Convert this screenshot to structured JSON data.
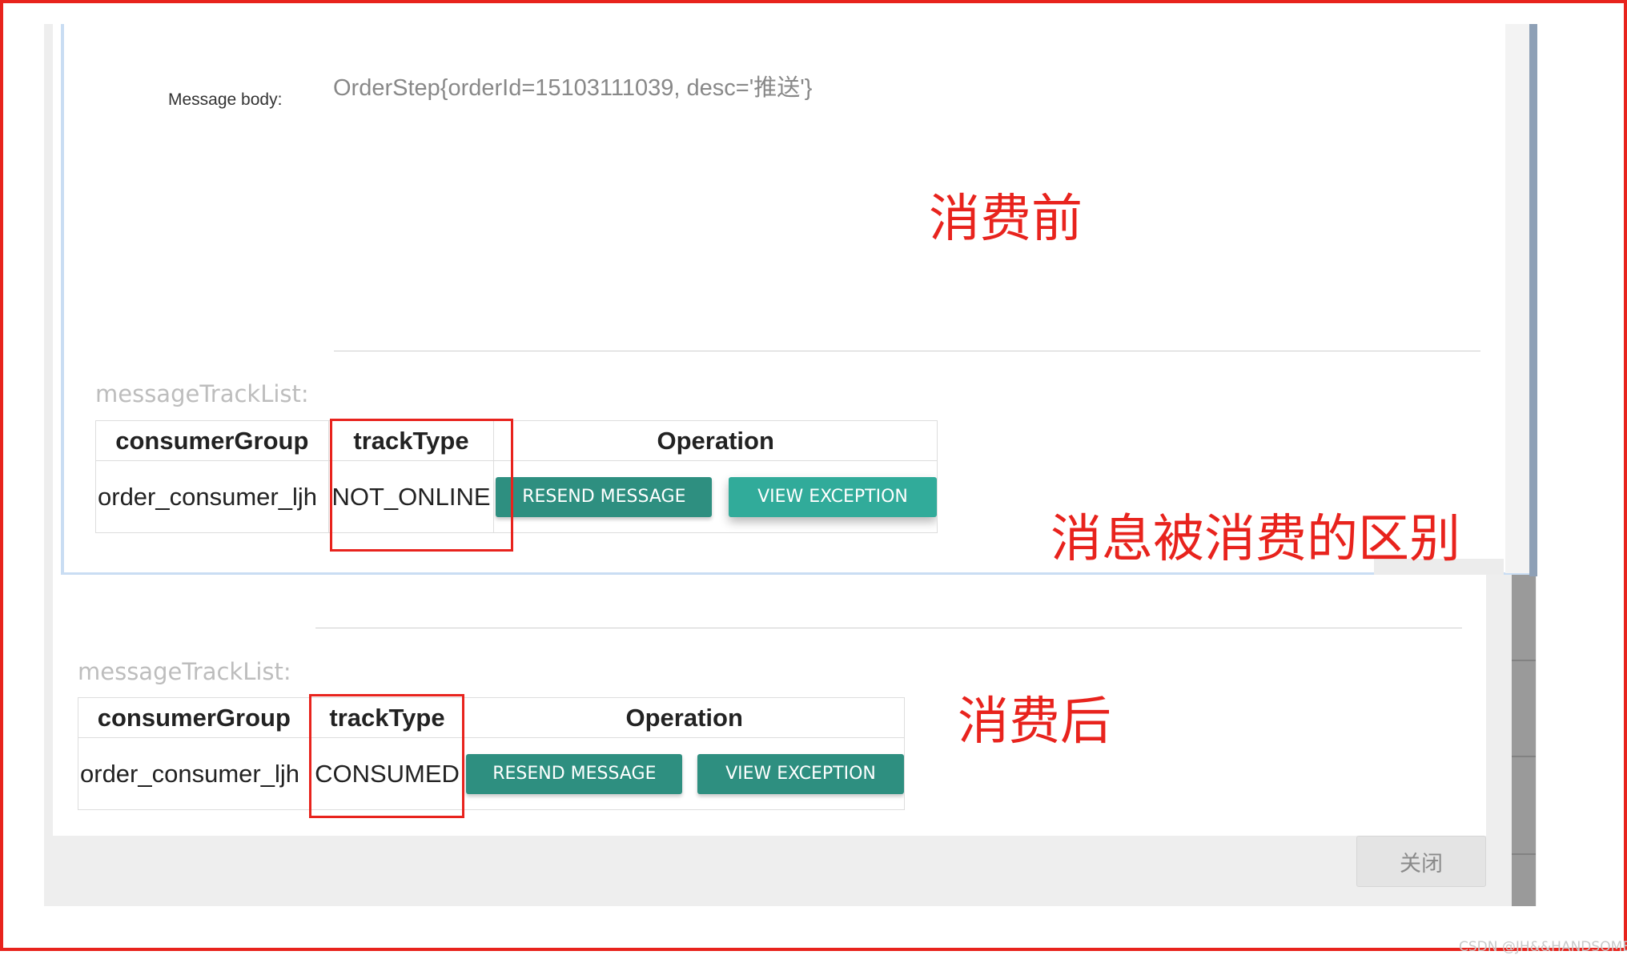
{
  "before": {
    "message_body_label": "Message body:",
    "message_body_value": "OrderStep{orderId=15103111039, desc='推送'}",
    "track_list_label": "messageTrackList:",
    "table": {
      "headers": [
        "consumerGroup",
        "trackType",
        "Operation"
      ],
      "row": {
        "consumer_group": "order_consumer_ljh",
        "track_type": "NOT_ONLINE"
      },
      "resend_label": "RESEND MESSAGE",
      "view_exception_label": "VIEW EXCEPTION"
    }
  },
  "after": {
    "track_list_label": "messageTrackList:",
    "table": {
      "headers": [
        "consumerGroup",
        "trackType",
        "Operation"
      ],
      "row": {
        "consumer_group": "order_consumer_ljh",
        "track_type": "CONSUMED"
      },
      "resend_label": "RESEND MESSAGE",
      "view_exception_label": "VIEW EXCEPTION"
    },
    "close_label": "关闭"
  },
  "annotations": {
    "before": "消费前",
    "difference": "消息被消费的区别",
    "after": "消费后"
  },
  "watermark": "CSDN @JH&&HANDSOME",
  "colors": {
    "annotation_red": "#e8231d",
    "button_teal": "#2e8f80",
    "button_teal_light": "#31ab9a"
  }
}
